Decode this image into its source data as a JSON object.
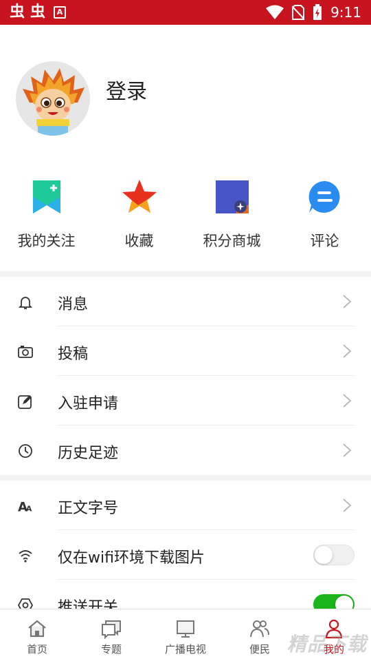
{
  "status_bar": {
    "app_glyph_1": "虫",
    "app_glyph_2": "虫",
    "notif_letter": "A",
    "time": "9:11"
  },
  "profile": {
    "login_label": "登录"
  },
  "quick_actions": [
    {
      "label": "我的关注",
      "icon": "bookmark-icon"
    },
    {
      "label": "收藏",
      "icon": "star-icon"
    },
    {
      "label": "积分商城",
      "icon": "points-mall-icon"
    },
    {
      "label": "评论",
      "icon": "comment-icon"
    }
  ],
  "menu_group_1": [
    {
      "label": "消息",
      "icon": "bell-icon"
    },
    {
      "label": "投稿",
      "icon": "camera-icon"
    },
    {
      "label": "入驻申请",
      "icon": "edit-icon"
    },
    {
      "label": "历史足迹",
      "icon": "clock-icon"
    }
  ],
  "menu_group_2": [
    {
      "label": "正文字号",
      "icon": "font-size-icon"
    },
    {
      "label": "仅在wifi环境下载图片",
      "icon": "wifi-icon",
      "toggle": "off"
    },
    {
      "label": "推送开关",
      "icon": "gear-icon",
      "toggle": "on"
    }
  ],
  "tabbar": [
    {
      "label": "首页",
      "icon": "home-icon"
    },
    {
      "label": "专题",
      "icon": "topic-icon"
    },
    {
      "label": "广播电视",
      "icon": "tv-icon"
    },
    {
      "label": "便民",
      "icon": "people-icon"
    },
    {
      "label": "我的",
      "icon": "user-icon",
      "active": true
    }
  ],
  "watermark": "精品下载",
  "colors": {
    "brand_red": "#c8141e",
    "toggle_on": "#1bb51b",
    "bookmark_green": "#1ec99a",
    "star_red": "#e8301e",
    "mall_blue": "#4855c6",
    "comment_blue": "#2a8cf0"
  }
}
